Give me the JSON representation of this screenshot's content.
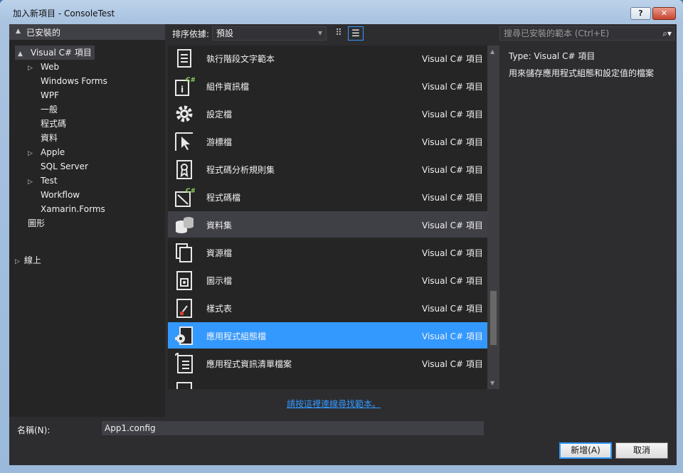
{
  "window": {
    "title": "加入新項目 - ConsoleTest",
    "help_label": "?",
    "close_label": "✕"
  },
  "left": {
    "installed_label": "已安裝的",
    "tree": [
      {
        "label": "Visual C# 項目",
        "expander": "▲",
        "selected": true
      },
      {
        "label": "Web",
        "expander": "▷"
      },
      {
        "label": "Windows Forms",
        "expander": ""
      },
      {
        "label": "WPF",
        "expander": ""
      },
      {
        "label": "一般",
        "expander": ""
      },
      {
        "label": "程式碼",
        "expander": ""
      },
      {
        "label": "資料",
        "expander": ""
      },
      {
        "label": "Apple",
        "expander": "▷"
      },
      {
        "label": "SQL Server",
        "expander": ""
      },
      {
        "label": "Test",
        "expander": "▷"
      },
      {
        "label": "Workflow",
        "expander": ""
      },
      {
        "label": "Xamarin.Forms",
        "expander": ""
      },
      {
        "label": "圖形",
        "expander": ""
      }
    ],
    "online_label": "線上"
  },
  "toolbar": {
    "sort_label": "排序依據:",
    "sort_value": "預設",
    "search_placeholder": "搜尋已安裝的範本 (Ctrl+E)"
  },
  "templates": [
    {
      "name": "執行階段文字範本",
      "lang": "Visual C# 項目",
      "icon": "text-template-icon"
    },
    {
      "name": "組件資訊檔",
      "lang": "Visual C# 項目",
      "icon": "assembly-info-icon"
    },
    {
      "name": "設定檔",
      "lang": "Visual C# 項目",
      "icon": "gear-icon"
    },
    {
      "name": "游標檔",
      "lang": "Visual C# 項目",
      "icon": "cursor-icon"
    },
    {
      "name": "程式碼分析規則集",
      "lang": "Visual C# 項目",
      "icon": "ruleset-icon"
    },
    {
      "name": "程式碼檔",
      "lang": "Visual C# 項目",
      "icon": "code-file-icon"
    },
    {
      "name": "資料集",
      "lang": "Visual C# 項目",
      "icon": "dataset-icon",
      "state": "hover"
    },
    {
      "name": "資源檔",
      "lang": "Visual C# 項目",
      "icon": "resource-file-icon"
    },
    {
      "name": "圖示檔",
      "lang": "Visual C# 項目",
      "icon": "icon-file-icon"
    },
    {
      "name": "樣式表",
      "lang": "Visual C# 項目",
      "icon": "stylesheet-icon"
    },
    {
      "name": "應用程式組態檔",
      "lang": "Visual C# 項目",
      "icon": "app-config-icon",
      "state": "selected"
    },
    {
      "name": "應用程式資訊清單檔案",
      "lang": "Visual C# 項目",
      "icon": "manifest-icon"
    },
    {
      "name": "",
      "lang": "",
      "icon": "partial-item-icon"
    }
  ],
  "find_link": "請按這裡連線尋找範本。",
  "info": {
    "type_label": "Type:",
    "type_value": "Visual C# 項目",
    "description": "用來儲存應用程式組態和設定值的檔案"
  },
  "bottom": {
    "name_label": "名稱(N):",
    "name_value": "App1.config",
    "add_label": "新增(A)",
    "cancel_label": "取消"
  }
}
